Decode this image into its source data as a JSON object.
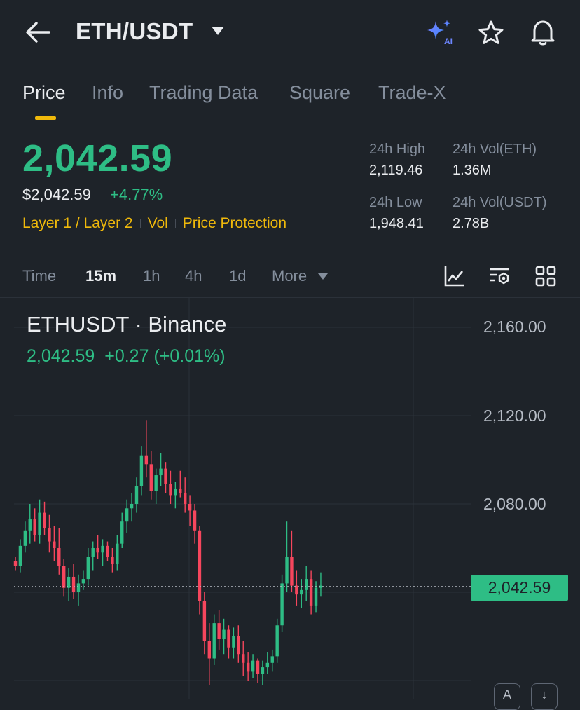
{
  "header": {
    "pair": "ETH/USDT",
    "ai_badge": "AI",
    "icons": [
      "back-arrow-icon",
      "chevron-down-icon",
      "ai-sparkle-icon",
      "star-icon",
      "bell-icon"
    ]
  },
  "tabs": [
    {
      "label": "Price",
      "active": true
    },
    {
      "label": "Info"
    },
    {
      "label": "Trading Data"
    },
    {
      "label": "Square"
    },
    {
      "label": "Trade-X"
    }
  ],
  "price": {
    "last": "2,042.59",
    "usd": "$2,042.59",
    "change": "+4.77%",
    "tags": [
      "Layer 1 / Layer 2",
      "Vol",
      "Price Protection"
    ]
  },
  "stats": {
    "high_label": "24h High",
    "high_value": "2,119.46",
    "vol_eth_label": "24h Vol(ETH)",
    "vol_eth_value": "1.36M",
    "low_label": "24h Low",
    "low_value": "1,948.41",
    "vol_usdt_label": "24h Vol(USDT)",
    "vol_usdt_value": "2.78B"
  },
  "intervals": [
    {
      "label": "Time"
    },
    {
      "label": "15m",
      "active": true
    },
    {
      "label": "1h"
    },
    {
      "label": "4h"
    },
    {
      "label": "1d"
    },
    {
      "label": "More"
    }
  ],
  "toolbar_icons": [
    "indicator-chart-icon",
    "chart-settings-icon",
    "grid-layout-icon"
  ],
  "chart": {
    "symbol": "ETHUSDT · Binance",
    "ohlc_close": "2,042.59",
    "ohlc_change": "+0.27",
    "ohlc_change_pct": "(+0.01%)",
    "y_ticks": [
      "2,160.00",
      "2,120.00",
      "2,080.00"
    ],
    "last_price_label": "2,042.59",
    "scroll_buttons": [
      "A",
      "↓"
    ]
  },
  "colors": {
    "up": "#2ebd85",
    "down": "#f6465d",
    "accent": "#f0b90b",
    "background": "#1e2329",
    "muted": "#848e9c"
  },
  "chart_data": {
    "type": "candlestick",
    "symbol": "ETHUSDT",
    "interval": "15m",
    "ylim": [
      1995,
      2170
    ],
    "last": 2042.59,
    "candles": [
      [
        2054,
        2056,
        2050,
        2052
      ],
      [
        2052,
        2064,
        2049,
        2061
      ],
      [
        2061,
        2072,
        2058,
        2068
      ],
      [
        2068,
        2080,
        2062,
        2073
      ],
      [
        2073,
        2078,
        2063,
        2066
      ],
      [
        2066,
        2082,
        2062,
        2076
      ],
      [
        2076,
        2081,
        2066,
        2069
      ],
      [
        2069,
        2075,
        2058,
        2063
      ],
      [
        2063,
        2070,
        2054,
        2060
      ],
      [
        2060,
        2069,
        2048,
        2052
      ],
      [
        2052,
        2055,
        2038,
        2042
      ],
      [
        2042,
        2051,
        2036,
        2047
      ],
      [
        2047,
        2053,
        2037,
        2040
      ],
      [
        2040,
        2048,
        2034,
        2044
      ],
      [
        2044,
        2050,
        2041,
        2046
      ],
      [
        2046,
        2060,
        2043,
        2056
      ],
      [
        2056,
        2063,
        2050,
        2060
      ],
      [
        2060,
        2066,
        2055,
        2058
      ],
      [
        2058,
        2064,
        2052,
        2061
      ],
      [
        2061,
        2063,
        2054,
        2056
      ],
      [
        2056,
        2060,
        2049,
        2053
      ],
      [
        2053,
        2066,
        2050,
        2062
      ],
      [
        2062,
        2076,
        2060,
        2072
      ],
      [
        2072,
        2082,
        2067,
        2078
      ],
      [
        2078,
        2085,
        2072,
        2080
      ],
      [
        2080,
        2092,
        2076,
        2088
      ],
      [
        2088,
        2106,
        2084,
        2102
      ],
      [
        2102,
        2118,
        2092,
        2098
      ],
      [
        2098,
        2104,
        2082,
        2086
      ],
      [
        2086,
        2096,
        2080,
        2093
      ],
      [
        2093,
        2103,
        2088,
        2096
      ],
      [
        2096,
        2099,
        2085,
        2089
      ],
      [
        2089,
        2095,
        2080,
        2084
      ],
      [
        2084,
        2090,
        2078,
        2087
      ],
      [
        2087,
        2095,
        2083,
        2085
      ],
      [
        2085,
        2092,
        2076,
        2080
      ],
      [
        2080,
        2084,
        2070,
        2077
      ],
      [
        2077,
        2080,
        2062,
        2068
      ],
      [
        2068,
        2070,
        2030,
        2036
      ],
      [
        2036,
        2040,
        2012,
        2018
      ],
      [
        2018,
        2026,
        1998,
        2010
      ],
      [
        2010,
        2030,
        2007,
        2026
      ],
      [
        2026,
        2032,
        2014,
        2019
      ],
      [
        2019,
        2028,
        2012,
        2023
      ],
      [
        2023,
        2025,
        2010,
        2015
      ],
      [
        2015,
        2024,
        2010,
        2020
      ],
      [
        2020,
        2025,
        2008,
        2012
      ],
      [
        2012,
        2018,
        2002,
        2008
      ],
      [
        2008,
        2013,
        2000,
        2004
      ],
      [
        2004,
        2012,
        2001,
        2009
      ],
      [
        2009,
        2010,
        1999,
        2003
      ],
      [
        2003,
        2009,
        1998,
        2006
      ],
      [
        2006,
        2013,
        2003,
        2008
      ],
      [
        2008,
        2014,
        2004,
        2011
      ],
      [
        2011,
        2028,
        2008,
        2025
      ],
      [
        2025,
        2048,
        2022,
        2044
      ],
      [
        2044,
        2072,
        2040,
        2056
      ],
      [
        2056,
        2068,
        2040,
        2043
      ],
      [
        2043,
        2050,
        2034,
        2039
      ],
      [
        2039,
        2046,
        2033,
        2041
      ],
      [
        2041,
        2052,
        2036,
        2046
      ],
      [
        2046,
        2050,
        2030,
        2034
      ],
      [
        2034,
        2045,
        2031,
        2042
      ],
      [
        2042,
        2049,
        2038,
        2043
      ]
    ]
  }
}
